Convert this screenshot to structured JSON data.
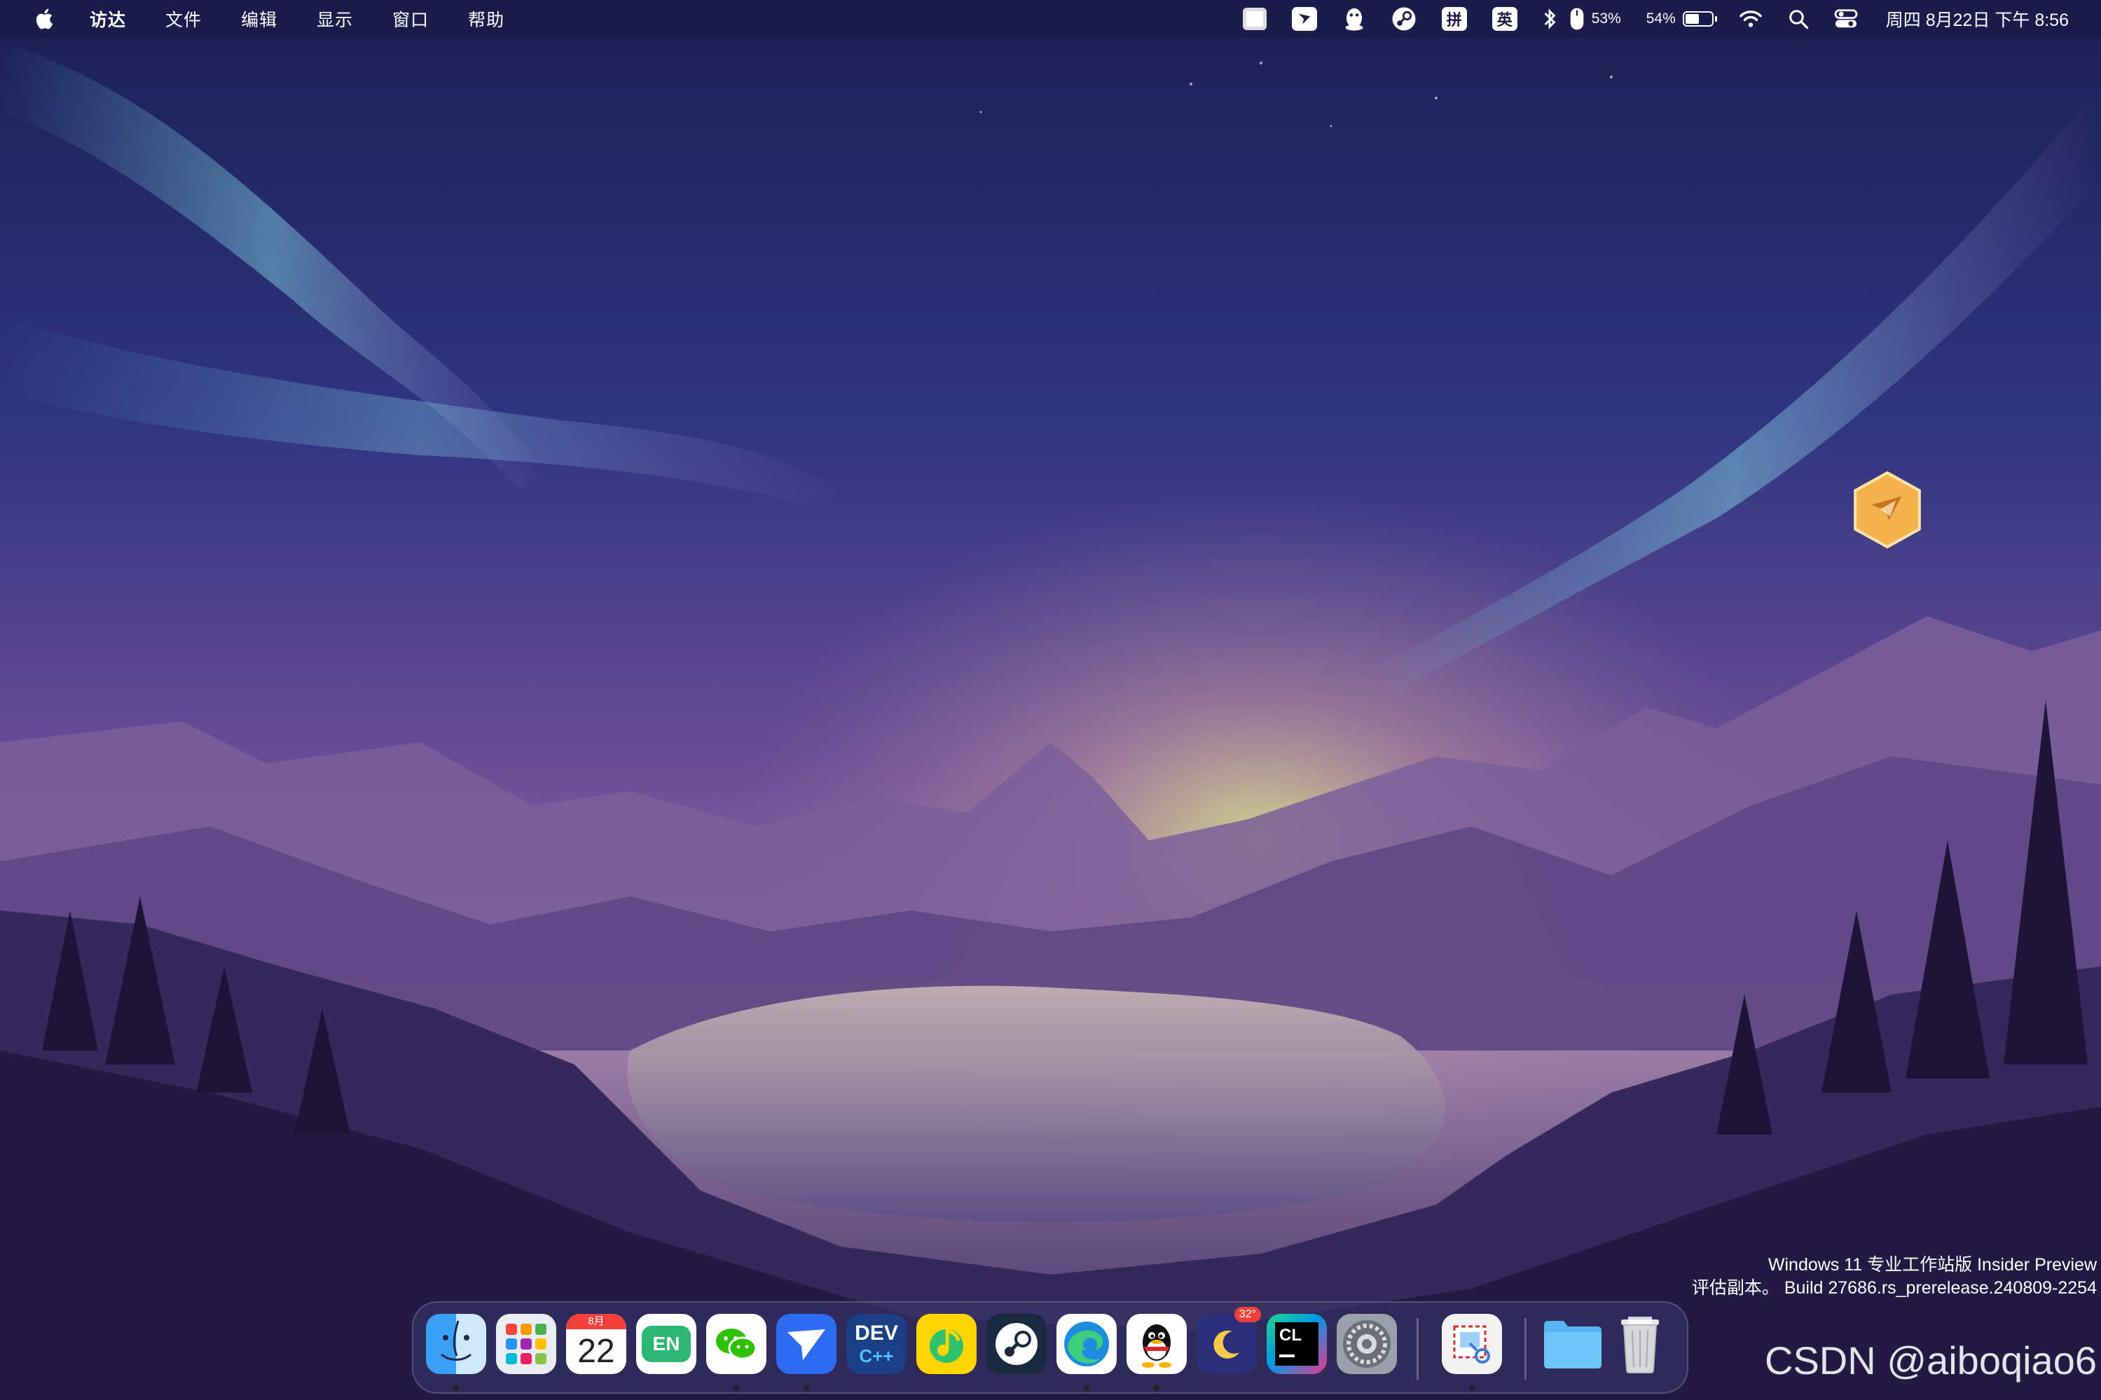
{
  "menubar": {
    "apple_icon": "apple-logo-icon",
    "items": [
      "访达",
      "文件",
      "编辑",
      "显示",
      "窗口",
      "帮助"
    ],
    "status_icons": [
      "stop-icon",
      "feishu-icon",
      "qq-icon",
      "steam-icon",
      "pinyin-icon",
      "english-icon",
      "bluetooth-icon",
      "mouse-icon",
      "battery-icon",
      "wifi-icon",
      "search-icon",
      "control-center-icon"
    ],
    "pinyin_label": "拼",
    "english_label": "英",
    "mouse_battery": "53%",
    "battery_percent": "54%",
    "battery_level": 0.54,
    "clock": "周四 8月22日 下午 8:56"
  },
  "desktop": {
    "icon": "feishu-hexagon-icon"
  },
  "watermark": {
    "line1": "Windows 11 专业工作站版 Insider Preview",
    "line2": "评估副本。 Build 27686.rs_prerelease.240809-2254",
    "csdn": "CSDN @aiboqiao6"
  },
  "dock": {
    "apps": [
      {
        "name": "finder",
        "icon": "finder-icon",
        "running": true
      },
      {
        "name": "launchpad",
        "icon": "launchpad-icon",
        "running": false
      },
      {
        "name": "calendar",
        "icon": "calendar-icon",
        "running": false,
        "month": "8月",
        "day": "22"
      },
      {
        "name": "eudic",
        "icon": "eudic-icon",
        "running": false,
        "label": "EN"
      },
      {
        "name": "wechat",
        "icon": "wechat-icon",
        "running": true
      },
      {
        "name": "feishu",
        "icon": "feishu-icon",
        "running": true
      },
      {
        "name": "devcpp",
        "icon": "devcpp-icon",
        "running": false,
        "label_top": "DEV",
        "label_bottom": "C++"
      },
      {
        "name": "qqmusic",
        "icon": "qqmusic-icon",
        "running": false
      },
      {
        "name": "steam",
        "icon": "steam-icon",
        "running": false
      },
      {
        "name": "edge",
        "icon": "edge-icon",
        "running": true
      },
      {
        "name": "qq",
        "icon": "qq-icon",
        "running": true
      },
      {
        "name": "weather",
        "icon": "moon-weather-icon",
        "running": false,
        "badge": "32°"
      },
      {
        "name": "clion",
        "icon": "clion-icon",
        "running": false,
        "label": "CL"
      },
      {
        "name": "system-settings",
        "icon": "gear-icon",
        "running": false
      },
      {
        "name": "preview",
        "icon": "preview-icon",
        "running": true
      },
      {
        "name": "folder",
        "icon": "folder-icon",
        "running": false
      },
      {
        "name": "trash",
        "icon": "trash-icon",
        "running": false
      }
    ]
  }
}
